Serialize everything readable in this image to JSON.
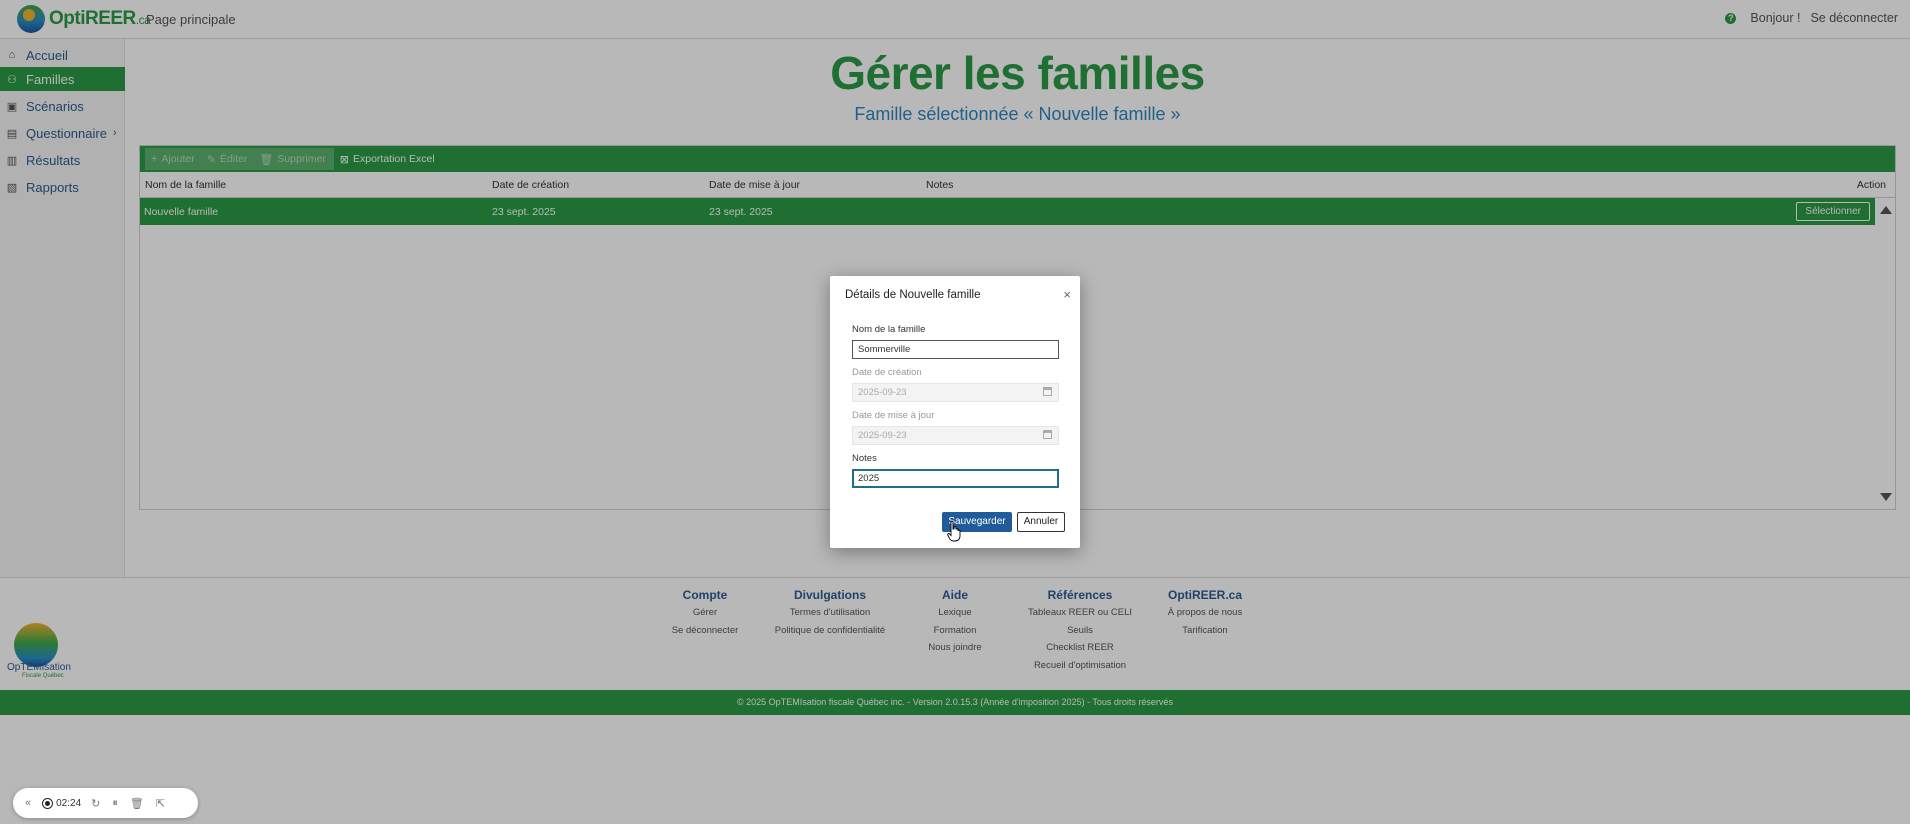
{
  "header": {
    "logo_text": "OptiREER",
    "logo_suffix": ".ca",
    "home_link": "Page principale",
    "greeting": "Bonjour !",
    "logout": "Se déconnecter",
    "help_glyph": "?"
  },
  "sidebar": {
    "items": [
      {
        "label": "Accueil",
        "icon": "home-icon",
        "glyph": "⌂",
        "active": false
      },
      {
        "label": "Familles",
        "icon": "family-icon",
        "glyph": "⚇",
        "active": true
      },
      {
        "label": "Scénarios",
        "icon": "scenario-icon",
        "glyph": "▣",
        "active": false
      },
      {
        "label": "Questionnaire",
        "icon": "questionnaire-icon",
        "glyph": "▤",
        "active": false,
        "chevron": "›"
      },
      {
        "label": "Résultats",
        "icon": "chart-icon",
        "glyph": "▥",
        "active": false
      },
      {
        "label": "Rapports",
        "icon": "report-icon",
        "glyph": "▧",
        "active": false
      }
    ]
  },
  "main": {
    "title": "Gérer les familles",
    "subtitle": "Famille sélectionnée « Nouvelle famille »"
  },
  "grid": {
    "toolbar": {
      "add": "Ajouter",
      "edit": "Éditer",
      "delete": "Supprimer",
      "export": "Exportation Excel"
    },
    "columns": {
      "name": "Nom de la famille",
      "created": "Date de création",
      "updated": "Date de mise à jour",
      "notes": "Notes",
      "action": "Action"
    },
    "rows": [
      {
        "name": "Nouvelle famille",
        "created": "23 sept. 2025",
        "updated": "23 sept. 2025",
        "notes": "",
        "action": "Sélectionner"
      }
    ]
  },
  "modal": {
    "title": "Détails de Nouvelle famille",
    "close_glyph": "×",
    "fields": {
      "name_label": "Nom de la famille",
      "name_value": "Sommerville",
      "created_label": "Date de création",
      "created_value": "2025-09-23",
      "updated_label": "Date de mise à jour",
      "updated_value": "2025-09-23",
      "notes_label": "Notes",
      "notes_value": "2025"
    },
    "save": "Sauvegarder",
    "cancel": "Annuler"
  },
  "footer": {
    "logo_text": "OpTEMIsation",
    "logo_sub": "Fiscale Québec",
    "columns": [
      {
        "heading": "Compte",
        "links": [
          "Gérer",
          "Se déconnecter"
        ]
      },
      {
        "heading": "Divulgations",
        "links": [
          "Termes d'utilisation",
          "Politique de confidentialité"
        ]
      },
      {
        "heading": "Aide",
        "links": [
          "Lexique",
          "Formation",
          "Nous joindre"
        ]
      },
      {
        "heading": "Références",
        "links": [
          "Tableaux REER ou CELI",
          "Seuils",
          "Checklist REER",
          "Recueil d'optimisation"
        ]
      },
      {
        "heading": "OptiREER.ca",
        "links": [
          "À propos de nous",
          "Tarification"
        ]
      }
    ],
    "copyright": "© 2025 OpTEMIsation fiscale Québec inc. - Version 2.0.15.3 (Année d'imposition 2025) - Tous droits réservés"
  },
  "recorder": {
    "collapse_glyph": "«",
    "time": "02:24",
    "restart_glyph": "↻",
    "pause_glyph": "⏸",
    "delete_glyph": "🗑",
    "pointer_glyph": "⇱"
  },
  "colors": {
    "brand_green": "#2a9a44",
    "brand_blue": "#2e86c1",
    "save_button": "#1f5c99"
  }
}
